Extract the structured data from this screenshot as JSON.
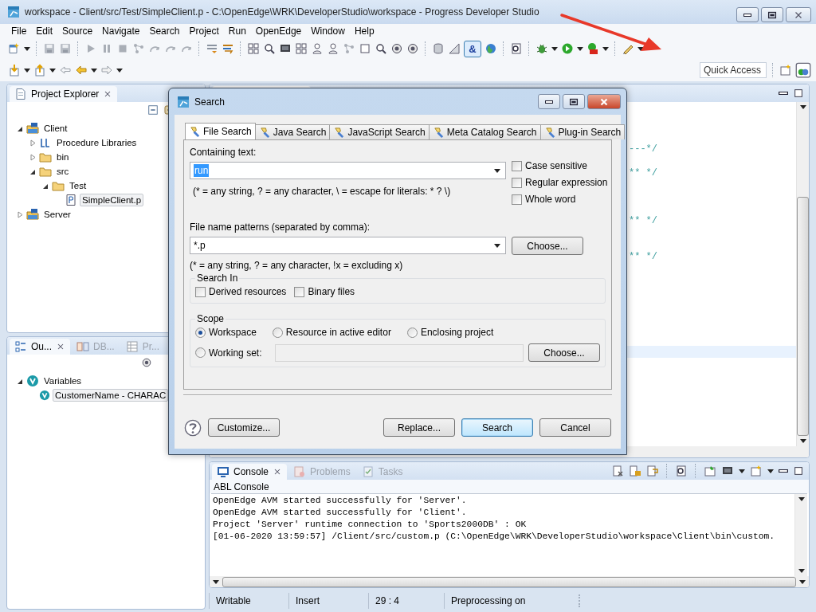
{
  "window": {
    "title": "workspace - Client/src/Test/SimpleClient.p - C:\\OpenEdge\\WRK\\DeveloperStudio\\workspace - Progress Developer Studio"
  },
  "menu": [
    "File",
    "Edit",
    "Source",
    "Navigate",
    "Search",
    "Project",
    "Run",
    "OpenEdge",
    "Window",
    "Help"
  ],
  "toolbar": {
    "toggle": {
      "label": "&",
      "selected": true
    },
    "quick_access": {
      "placeholder": "Quick Access"
    }
  },
  "project_explorer": {
    "title": "Project Explorer",
    "tree": [
      {
        "label": "Client",
        "kind": "project",
        "expanded": true,
        "selected": false,
        "children": [
          {
            "label": "Procedure Libraries",
            "kind": "library",
            "expanded": false,
            "selected": false
          },
          {
            "label": "bin",
            "kind": "folder",
            "expanded": false,
            "selected": false
          },
          {
            "label": "src",
            "kind": "folder",
            "expanded": true,
            "selected": false,
            "children": [
              {
                "label": "Test",
                "kind": "folder",
                "expanded": true,
                "selected": false,
                "children": [
                  {
                    "label": "SimpleClient.p",
                    "kind": "file",
                    "selected": true
                  }
                ]
              }
            ]
          }
        ]
      },
      {
        "label": "Server",
        "kind": "project",
        "expanded": false,
        "selected": false
      }
    ]
  },
  "outline": {
    "tabs": [
      {
        "label": "Ou...",
        "kind": "outline",
        "selected": true
      },
      {
        "label": "DB...",
        "kind": "db",
        "selected": false
      },
      {
        "label": "Pr...",
        "kind": "table",
        "selected": false
      }
    ],
    "tree": [
      {
        "label": "Variables",
        "kind": "variables",
        "expanded": true,
        "selected": false,
        "children": [
          {
            "label": "CustomerName - CHARAC",
            "kind": "variable",
            "selected": true
          }
        ]
      }
    ]
  },
  "editor": {
    "lines": [
      {
        "kind": "blank"
      },
      {
        "kind": "blank"
      },
      {
        "kind": "blank"
      },
      {
        "kind": "code",
        "text": "---*/"
      },
      {
        "kind": "blank"
      },
      {
        "kind": "code",
        "text": "** */"
      },
      {
        "kind": "blank"
      },
      {
        "kind": "blank"
      },
      {
        "kind": "blank"
      },
      {
        "kind": "code",
        "text": "** */"
      },
      {
        "kind": "blank"
      },
      {
        "kind": "blank"
      },
      {
        "kind": "code",
        "text": "** */"
      },
      {
        "kind": "blank"
      },
      {
        "kind": "blank"
      },
      {
        "kind": "blank"
      },
      {
        "kind": "blank"
      },
      {
        "kind": "blank"
      },
      {
        "kind": "blank"
      },
      {
        "kind": "blank"
      },
      {
        "kind": "current"
      },
      {
        "kind": "blank"
      },
      {
        "kind": "blank"
      },
      {
        "kind": "blank"
      },
      {
        "kind": "blank"
      },
      {
        "kind": "blank"
      },
      {
        "kind": "blank"
      }
    ]
  },
  "search_dialog": {
    "title": "Search",
    "tabs": [
      {
        "label": "File Search",
        "selected": true
      },
      {
        "label": "Java Search",
        "selected": false
      },
      {
        "label": "JavaScript Search",
        "selected": false
      },
      {
        "label": "Meta Catalog Search",
        "selected": false
      },
      {
        "label": "Plug-in Search",
        "selected": false
      }
    ],
    "containing_text": {
      "label": "Containing text:",
      "value": "run",
      "value_highlighted": true
    },
    "containing_hint": "(* = any string, ? = any character, \\ = escape for literals: * ? \\)",
    "options": [
      {
        "label": "Case sensitive",
        "checked": false
      },
      {
        "label": "Regular expression",
        "checked": false
      },
      {
        "label": "Whole word",
        "checked": false
      }
    ],
    "file_patterns": {
      "label": "File name patterns (separated by comma):",
      "value": "*.p",
      "button": "Choose..."
    },
    "patterns_hint": "(* = any string, ? = any character, !x = excluding x)",
    "search_in": {
      "title": "Search In",
      "options": [
        {
          "label": "Derived resources",
          "checked": false
        },
        {
          "label": "Binary files",
          "checked": false
        }
      ]
    },
    "scope": {
      "title": "Scope",
      "options": [
        {
          "label": "Workspace",
          "selected": true
        },
        {
          "label": "Resource in active editor",
          "selected": false
        },
        {
          "label": "Enclosing project",
          "selected": false
        },
        {
          "label": "Working set:",
          "selected": false
        }
      ],
      "working_set_disabled": true,
      "button": "Choose..."
    },
    "left_buttons": [
      {
        "label": "Customize...",
        "default": false
      }
    ],
    "right_buttons": [
      {
        "label": "Replace...",
        "default": false
      },
      {
        "label": "Search",
        "default": true
      },
      {
        "label": "Cancel",
        "default": false
      }
    ]
  },
  "console": {
    "tabs": [
      {
        "label": "Console",
        "kind": "console",
        "selected": true
      },
      {
        "label": "Problems",
        "kind": "problems",
        "selected": false
      },
      {
        "label": "Tasks",
        "kind": "tasks",
        "selected": false
      }
    ],
    "title": "ABL Console",
    "lines": [
      "OpenEdge AVM started successfully for 'Server'.",
      "OpenEdge AVM started successfully for 'Client'.",
      "Project 'Server' runtime connection to 'Sports2000DB' : OK",
      "[01-06-2020 13:59:57] /Client/src/custom.p (C:\\OpenEdge\\WRK\\DeveloperStudio\\workspace\\Client\\bin\\custom."
    ]
  },
  "status_bar": [
    "Writable",
    "Insert",
    "29 : 4",
    "Preprocessing on"
  ]
}
